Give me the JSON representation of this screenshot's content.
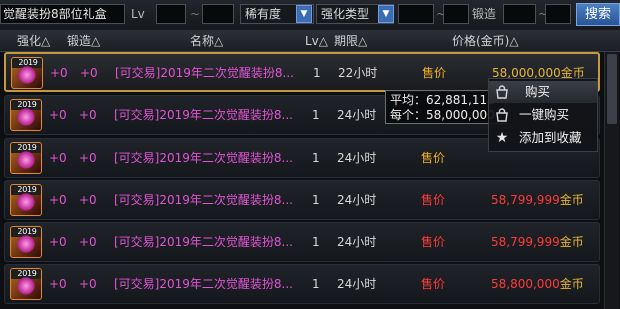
{
  "search": {
    "item_name_value": "觉醒装扮8部位礼盒",
    "lv_label": "Lv",
    "lv_min": "",
    "lv_max": "",
    "rarity_label": "稀有度",
    "enhance_type_label": "强化类型",
    "enhance_min": "",
    "forge_label": "锻造",
    "forge_min": "",
    "search_button": "搜索"
  },
  "header": {
    "enhance": "强化△",
    "forge": "锻造△",
    "name": "名称△",
    "lv": "Lv△",
    "duration": "期限△",
    "price": "价格(金币)△"
  },
  "rows": [
    {
      "enhance": "+0",
      "forge": "+0",
      "name": "[可交易]2019年二次觉醒装扮8...",
      "lv": "1",
      "duration": "22小时",
      "label": "售价",
      "price": "58,000,000",
      "currency": "金币",
      "red": false,
      "icon_year": "2019"
    },
    {
      "enhance": "+0",
      "forge": "+0",
      "name": "[可交易]2019年二次觉醒装扮8...",
      "lv": "1",
      "duration": "24小时",
      "label": "",
      "price": "",
      "currency": "",
      "red": false,
      "icon_year": "2019"
    },
    {
      "enhance": "+0",
      "forge": "+0",
      "name": "[可交易]2019年二次觉醒装扮8...",
      "lv": "1",
      "duration": "24小时",
      "label": "售价",
      "price": "",
      "currency": "",
      "red": false,
      "icon_year": "2019"
    },
    {
      "enhance": "+0",
      "forge": "+0",
      "name": "[可交易]2019年二次觉醒装扮8...",
      "lv": "1",
      "duration": "24小时",
      "label": "售价",
      "price": "58,799,999",
      "currency": "金币",
      "red": true,
      "icon_year": "2019"
    },
    {
      "enhance": "+0",
      "forge": "+0",
      "name": "[可交易]2019年二次觉醒装扮8...",
      "lv": "1",
      "duration": "24小时",
      "label": "售价",
      "price": "58,799,999",
      "currency": "金币",
      "red": true,
      "icon_year": "2019"
    },
    {
      "enhance": "+0",
      "forge": "+0",
      "name": "[可交易]2019年二次觉醒装扮8...",
      "lv": "1",
      "duration": "24小时",
      "label": "售价",
      "price": "58,800,000",
      "currency": "金币",
      "red": true,
      "icon_year": "2019"
    }
  ],
  "tooltip": {
    "avg_label": "平均：",
    "avg_value": "62,881,111",
    "each_label": "每个：",
    "each_value": "58,000,000"
  },
  "menu": {
    "items": [
      {
        "label": "购买",
        "icon": "buy-icon"
      },
      {
        "label": "一键购买",
        "icon": "quick-buy-icon"
      },
      {
        "label": "添加到收藏",
        "icon": "star-icon"
      }
    ]
  },
  "colors": {
    "item_name": "#e154d5",
    "price_gold": "#e6b53a",
    "price_red": "#ff3a3a",
    "selected_border": "#c69a3c",
    "search_button": "#3a6db3"
  }
}
